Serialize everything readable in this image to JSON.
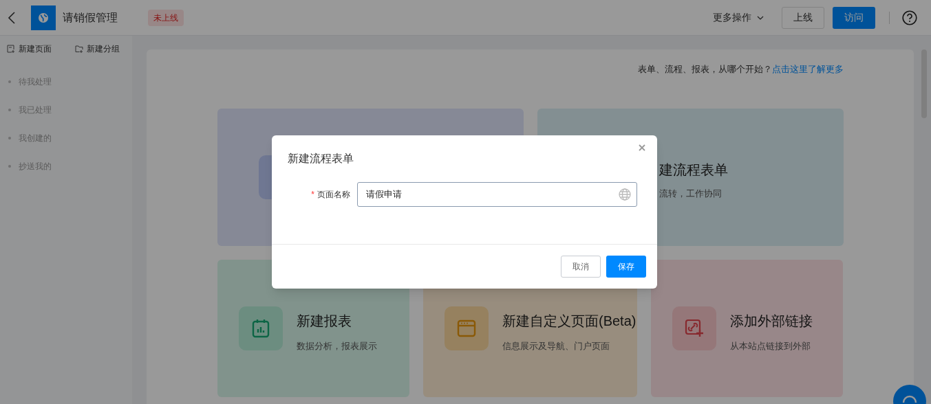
{
  "header": {
    "title": "请销假管理",
    "status_badge": "未上线",
    "more_actions": "更多操作",
    "buttons": [
      {
        "label": "上线",
        "kind": "default"
      },
      {
        "label": "访问",
        "kind": "primary"
      }
    ]
  },
  "sidebar": {
    "actions": [
      {
        "label": "新建页面",
        "kind": "page"
      },
      {
        "label": "新建分组",
        "kind": "folder"
      }
    ],
    "items": [
      {
        "label": "待我处理"
      },
      {
        "label": "我已处理"
      },
      {
        "label": "我创建的"
      },
      {
        "label": "抄送我的"
      }
    ]
  },
  "main": {
    "hint": "表单、流程、报表，从哪个开始？",
    "hint_link": "点击这里了解更多",
    "top_cards": [
      {
        "kind": "form"
      },
      {
        "kind": "flow",
        "title": "建流程表单",
        "description": "流转，工作协同"
      }
    ],
    "cards": [
      {
        "kind": "report",
        "title": "新建报表",
        "description": "数据分析，报表展示"
      },
      {
        "kind": "custom",
        "title": "新建自定义页面(Beta)",
        "description": "信息展示及导航、门户页面"
      },
      {
        "kind": "link",
        "title": "添加外部链接",
        "description": "从本站点链接到外部"
      }
    ]
  },
  "dialog": {
    "title": "新建流程表单",
    "field": {
      "required_mark": "*",
      "label": "页面名称",
      "value": "请假申请"
    },
    "buttons": [
      {
        "label": "取消",
        "kind": "default"
      },
      {
        "label": "保存",
        "kind": "primary"
      }
    ]
  }
}
